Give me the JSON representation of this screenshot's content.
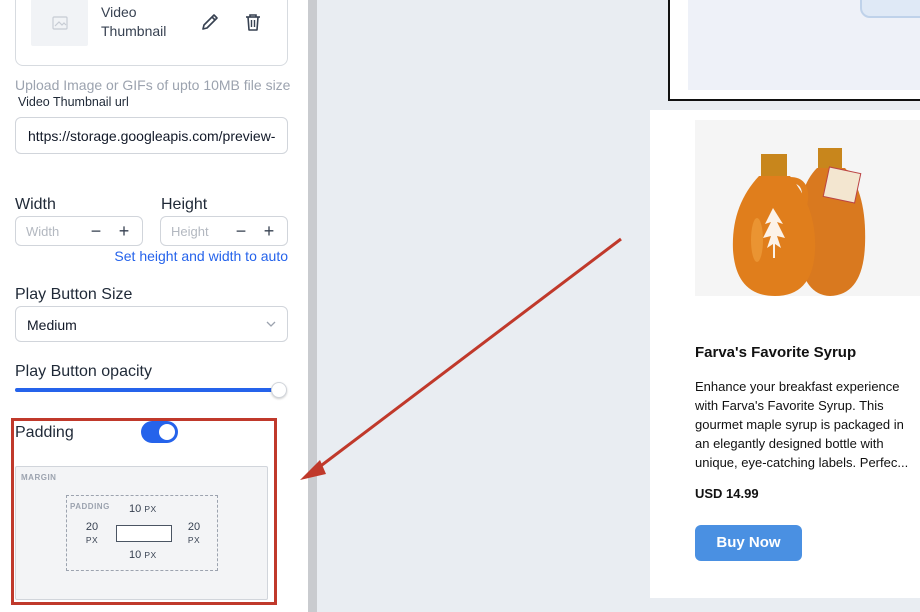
{
  "thumbnail": {
    "name": "Video Thumbnail",
    "edit_icon": "pencil-icon",
    "delete_icon": "trash-icon",
    "upload_hint": "Upload Image or GIFs of upto 10MB file size"
  },
  "video_url": {
    "label": "Video Thumbnail url",
    "value": "https://storage.googleapis.com/preview-"
  },
  "dimensions": {
    "width_label": "Width",
    "width_placeholder": "Width",
    "height_label": "Height",
    "height_placeholder": "Height",
    "minus": "−",
    "plus": "+",
    "auto_link": "Set height and width to auto"
  },
  "play_button_size": {
    "label": "Play Button Size",
    "value": "Medium"
  },
  "play_button_opacity": {
    "label": "Play Button opacity",
    "value_fraction": 1.0
  },
  "padding": {
    "label": "Padding",
    "enabled": true,
    "margin_label": "MARGIN",
    "padding_label": "PADDING",
    "top": "10",
    "bottom": "10",
    "left": "20",
    "right": "20",
    "unit": "PX"
  },
  "product": {
    "title": "Farva's Favorite Syrup",
    "description": "Enhance your breakfast experience with Farva's Favorite Syrup. This gourmet maple syrup is packaged in an elegantly designed bottle with unique, eye-catching labels. Perfec...",
    "price": "USD 14.99",
    "buy_label": "Buy Now"
  },
  "colors": {
    "accent": "#2563eb",
    "highlight": "#c0392b",
    "buy_button": "#4a90e2"
  }
}
